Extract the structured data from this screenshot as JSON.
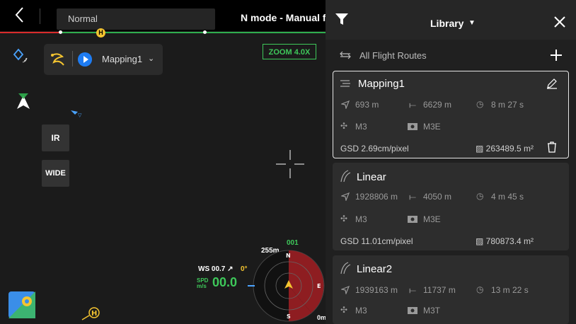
{
  "topbar": {
    "mode_text": "Normal",
    "status_text": "N mode - Manual flight",
    "home_marker": "H",
    "progress": 0.1
  },
  "left": {
    "route_name": "Mapping1",
    "ir_label": "IR",
    "wide_label": "WIDE",
    "zoom": "ZOOM 4.0X"
  },
  "hud": {
    "ws_label": "WS",
    "ws_value": "00.7 ↗",
    "ws_zero": "0°",
    "spd_label": "SPD m/s",
    "spd_value": "00.0",
    "altitude": "255m",
    "heading": "001",
    "compass_n": "N",
    "compass_s": "S",
    "compass_e": "E",
    "bottom_alt": "0m",
    "home_marker": "H"
  },
  "panel": {
    "library_label": "Library",
    "all_routes_label": "All Flight Routes",
    "routes": [
      {
        "name": "Mapping1",
        "distance": "693 m",
        "length": "6629 m",
        "duration": "8 m 27 s",
        "aircraft": "M3",
        "camera": "M3E",
        "gsd": "2.69cm/pixel",
        "area": "263489.5 m²"
      },
      {
        "name": "Linear",
        "distance": "1928806 m",
        "length": "4050 m",
        "duration": "4 m 45 s",
        "aircraft": "M3",
        "camera": "M3E",
        "gsd": "11.01cm/pixel",
        "area": "780873.4 m²"
      },
      {
        "name": "Linear2",
        "distance": "1939163 m",
        "length": "11737 m",
        "duration": "13 m 22 s",
        "aircraft": "M3",
        "camera": "M3T"
      }
    ]
  },
  "colors": {
    "accent_green": "#3ec85a",
    "accent_yellow": "#f4c430",
    "accent_blue": "#1e7cf2",
    "danger_red": "#d92b2b"
  }
}
